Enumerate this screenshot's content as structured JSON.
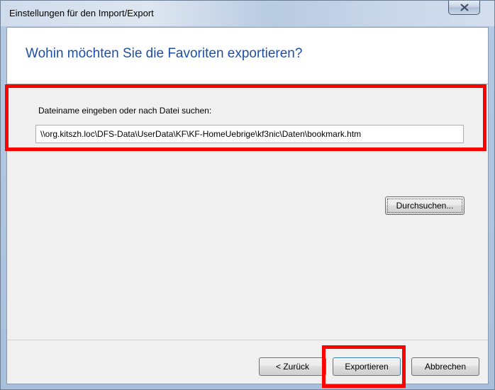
{
  "window": {
    "title": "Einstellungen für den Import/Export",
    "close_icon": "close-icon"
  },
  "header": {
    "heading": "Wohin möchten Sie die Favoriten exportieren?"
  },
  "main": {
    "field_label": "Dateiname eingeben oder nach Datei suchen:",
    "path_value": "\\\\org.kitszh.loc\\DFS-Data\\UserData\\KF\\KF-HomeUebrige\\kf3nic\\Daten\\bookmark.htm",
    "browse_label": "Durchsuchen..."
  },
  "footer": {
    "back_label": "< Zurück",
    "export_label": "Exportieren",
    "cancel_label": "Abbrechen"
  },
  "annotations": {
    "highlight_color": "#ff0000"
  }
}
